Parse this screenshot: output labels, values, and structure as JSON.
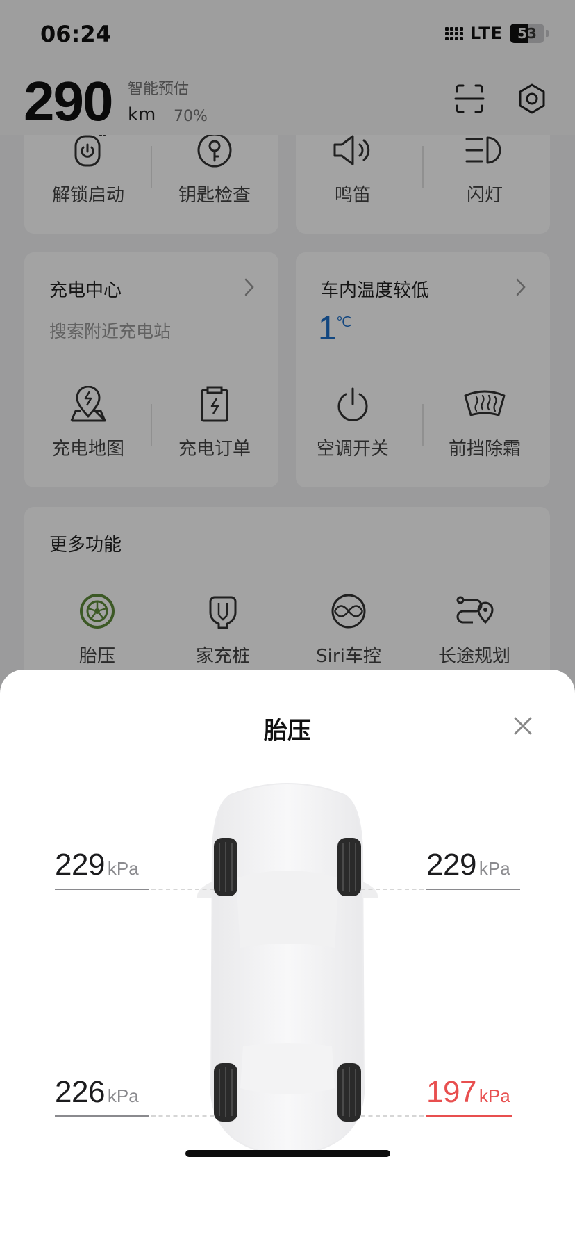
{
  "status": {
    "time": "06:24",
    "network": "LTE",
    "battery": "53",
    "battery_level": 0.53
  },
  "header": {
    "range_value": "290",
    "range_label": "智能预估",
    "range_unit": "km",
    "range_percent": "70%"
  },
  "quick_actions": {
    "left": [
      {
        "label": "解锁启动",
        "icon": "power-unlock-icon"
      },
      {
        "label": "钥匙检查",
        "icon": "key-icon"
      }
    ],
    "right": [
      {
        "label": "鸣笛",
        "icon": "horn-icon"
      },
      {
        "label": "闪灯",
        "icon": "headlight-icon"
      }
    ]
  },
  "charging": {
    "title": "充电中心",
    "subtitle": "搜索附近充电站",
    "actions": [
      {
        "label": "充电地图",
        "icon": "charge-map-icon"
      },
      {
        "label": "充电订单",
        "icon": "charge-order-icon"
      }
    ]
  },
  "climate": {
    "title": "车内温度较低",
    "temp_value": "1",
    "temp_unit": "℃",
    "actions": [
      {
        "label": "空调开关",
        "icon": "power-icon"
      },
      {
        "label": "前挡除霜",
        "icon": "defrost-icon"
      }
    ]
  },
  "more": {
    "title": "更多功能",
    "items": [
      {
        "label": "胎压",
        "icon": "tire-icon"
      },
      {
        "label": "家充桩",
        "icon": "home-charger-icon"
      },
      {
        "label": "Siri车控",
        "icon": "siri-icon"
      },
      {
        "label": "长途规划",
        "icon": "route-icon"
      }
    ]
  },
  "sheet": {
    "title": "胎压",
    "unit": "kPa",
    "tires": {
      "front_left": "229",
      "front_right": "229",
      "rear_left": "226",
      "rear_right": "197"
    }
  },
  "colors": {
    "warning": "#e84f4f",
    "temp_blue": "#1e6fc8",
    "tire_green": "#5e8b3a"
  }
}
